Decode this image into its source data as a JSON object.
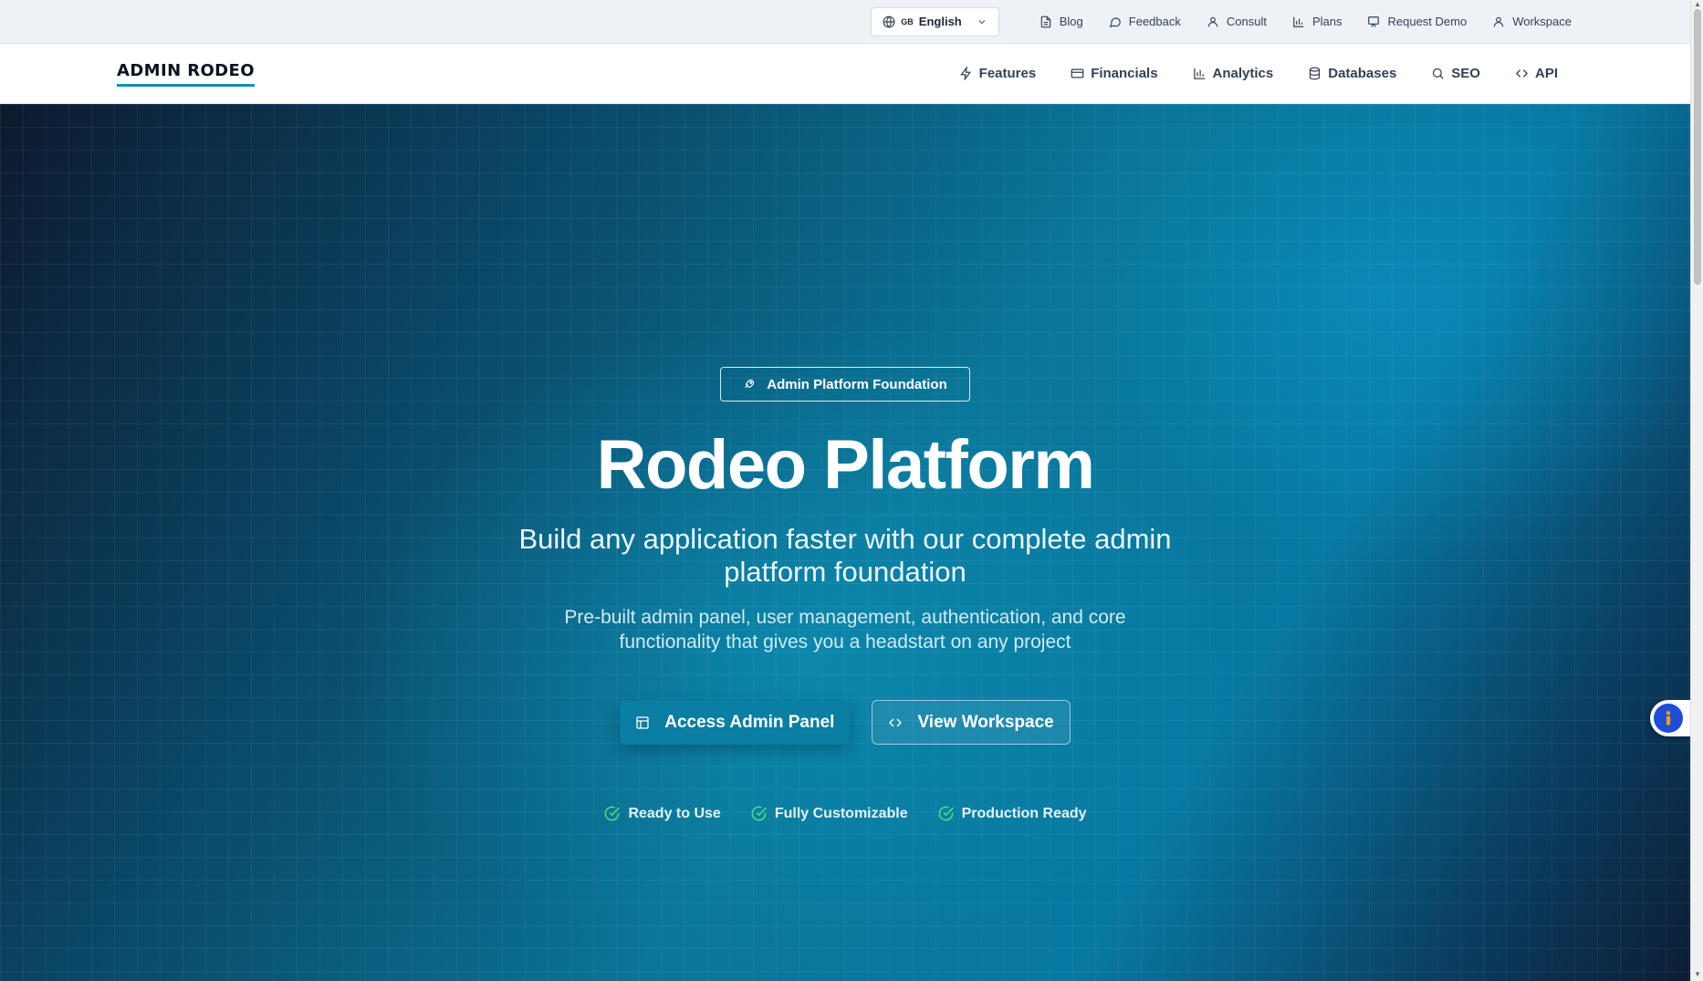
{
  "utility_bar": {
    "language": {
      "flag": "GB",
      "label": "English"
    },
    "links": [
      {
        "label": "Blog",
        "icon": "document-icon"
      },
      {
        "label": "Feedback",
        "icon": "chat-bubble-icon"
      },
      {
        "label": "Consult",
        "icon": "user-icon"
      },
      {
        "label": "Plans",
        "icon": "bar-chart-icon"
      },
      {
        "label": "Request Demo",
        "icon": "presentation-icon"
      },
      {
        "label": "Workspace",
        "icon": "user-icon"
      }
    ]
  },
  "main_nav": {
    "logo": "ADMIN RODEO",
    "links": [
      {
        "label": "Features",
        "icon": "lightning-icon"
      },
      {
        "label": "Financials",
        "icon": "credit-card-icon"
      },
      {
        "label": "Analytics",
        "icon": "bar-chart-icon"
      },
      {
        "label": "Databases",
        "icon": "database-icon"
      },
      {
        "label": "SEO",
        "icon": "search-icon"
      },
      {
        "label": "API",
        "icon": "code-icon"
      }
    ]
  },
  "hero": {
    "badge": "Admin Platform Foundation",
    "title": "Rodeo Platform",
    "subtitle": "Build any application faster with our complete admin platform foundation",
    "description": "Pre-built admin panel, user management, authentication, and core functionality that gives you a headstart on any project",
    "primary_cta": "Access Admin Panel",
    "secondary_cta": "View Workspace",
    "features": [
      "Ready to Use",
      "Fully Customizable",
      "Production Ready"
    ]
  },
  "colors": {
    "accent": "#0e92b4",
    "hero_dark": "#0d1a2f",
    "hero_mid": "#0a7597",
    "check_green": "#4ade80",
    "a11y_blue": "#1d4ed8"
  }
}
